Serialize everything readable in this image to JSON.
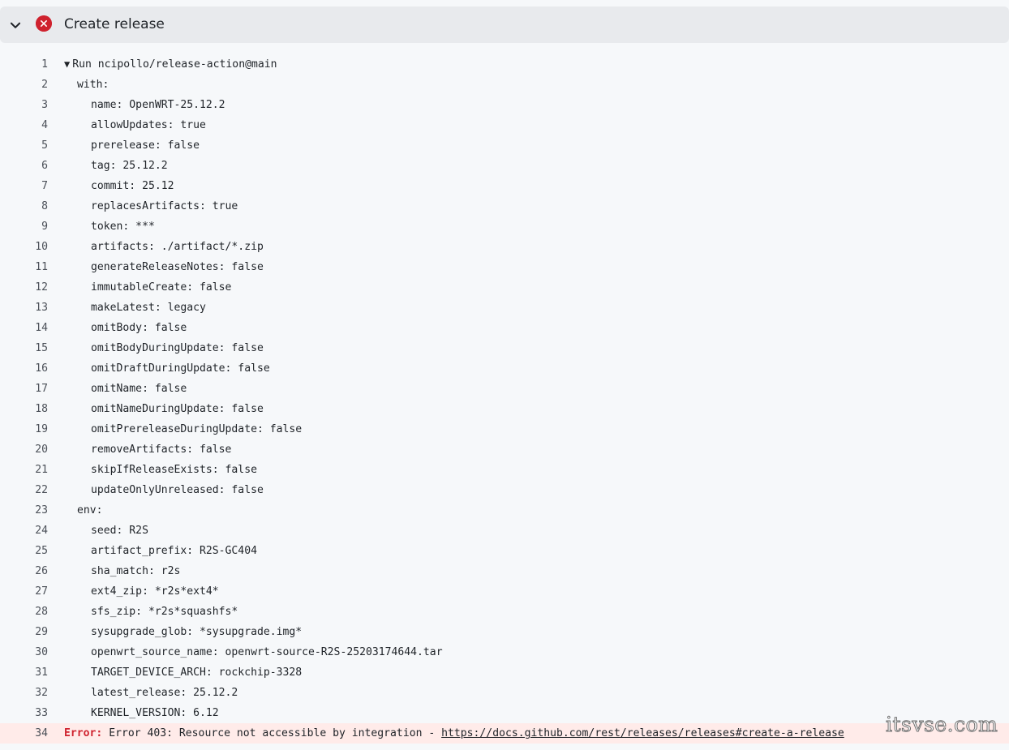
{
  "step": {
    "title": "Create release",
    "status": "failed",
    "status_color": "#cf222e",
    "expanded": true,
    "chevron_icon": "chevron-down-icon",
    "status_icon": "x-circle-fill-icon"
  },
  "log_lines": [
    {
      "num": "1",
      "indent": 0,
      "toggle": "▼",
      "text": "Run ncipollo/release-action@main"
    },
    {
      "num": "2",
      "indent": 1,
      "text": "with:"
    },
    {
      "num": "3",
      "indent": 2,
      "text": "name: OpenWRT-25.12.2"
    },
    {
      "num": "4",
      "indent": 2,
      "text": "allowUpdates: true"
    },
    {
      "num": "5",
      "indent": 2,
      "text": "prerelease: false"
    },
    {
      "num": "6",
      "indent": 2,
      "text": "tag: 25.12.2"
    },
    {
      "num": "7",
      "indent": 2,
      "text": "commit: 25.12"
    },
    {
      "num": "8",
      "indent": 2,
      "text": "replacesArtifacts: true"
    },
    {
      "num": "9",
      "indent": 2,
      "text": "token: ***"
    },
    {
      "num": "10",
      "indent": 2,
      "text": "artifacts: ./artifact/*.zip"
    },
    {
      "num": "11",
      "indent": 2,
      "text": "generateReleaseNotes: false"
    },
    {
      "num": "12",
      "indent": 2,
      "text": "immutableCreate: false"
    },
    {
      "num": "13",
      "indent": 2,
      "text": "makeLatest: legacy"
    },
    {
      "num": "14",
      "indent": 2,
      "text": "omitBody: false"
    },
    {
      "num": "15",
      "indent": 2,
      "text": "omitBodyDuringUpdate: false"
    },
    {
      "num": "16",
      "indent": 2,
      "text": "omitDraftDuringUpdate: false"
    },
    {
      "num": "17",
      "indent": 2,
      "text": "omitName: false"
    },
    {
      "num": "18",
      "indent": 2,
      "text": "omitNameDuringUpdate: false"
    },
    {
      "num": "19",
      "indent": 2,
      "text": "omitPrereleaseDuringUpdate: false"
    },
    {
      "num": "20",
      "indent": 2,
      "text": "removeArtifacts: false"
    },
    {
      "num": "21",
      "indent": 2,
      "text": "skipIfReleaseExists: false"
    },
    {
      "num": "22",
      "indent": 2,
      "text": "updateOnlyUnreleased: false"
    },
    {
      "num": "23",
      "indent": 1,
      "text": "env:"
    },
    {
      "num": "24",
      "indent": 2,
      "text": "seed: R2S"
    },
    {
      "num": "25",
      "indent": 2,
      "text": "artifact_prefix: R2S-GC404"
    },
    {
      "num": "26",
      "indent": 2,
      "text": "sha_match: r2s"
    },
    {
      "num": "27",
      "indent": 2,
      "text": "ext4_zip: *r2s*ext4*"
    },
    {
      "num": "28",
      "indent": 2,
      "text": "sfs_zip: *r2s*squashfs*"
    },
    {
      "num": "29",
      "indent": 2,
      "text": "sysupgrade_glob: *sysupgrade.img*"
    },
    {
      "num": "30",
      "indent": 2,
      "text": "openwrt_source_name: openwrt-source-R2S-25203174644.tar"
    },
    {
      "num": "31",
      "indent": 2,
      "text": "TARGET_DEVICE_ARCH: rockchip-3328"
    },
    {
      "num": "32",
      "indent": 2,
      "text": "latest_release: 25.12.2"
    },
    {
      "num": "33",
      "indent": 2,
      "text": "KERNEL_VERSION: 6.12"
    }
  ],
  "error_line": {
    "num": "34",
    "label": "Error:",
    "message": " Error 403: Resource not accessible by integration - ",
    "link": "https://docs.github.com/rest/releases/releases#create-a-release",
    "background": "#ffebe9",
    "label_color": "#cf222e"
  },
  "watermark": "itsvse.com"
}
